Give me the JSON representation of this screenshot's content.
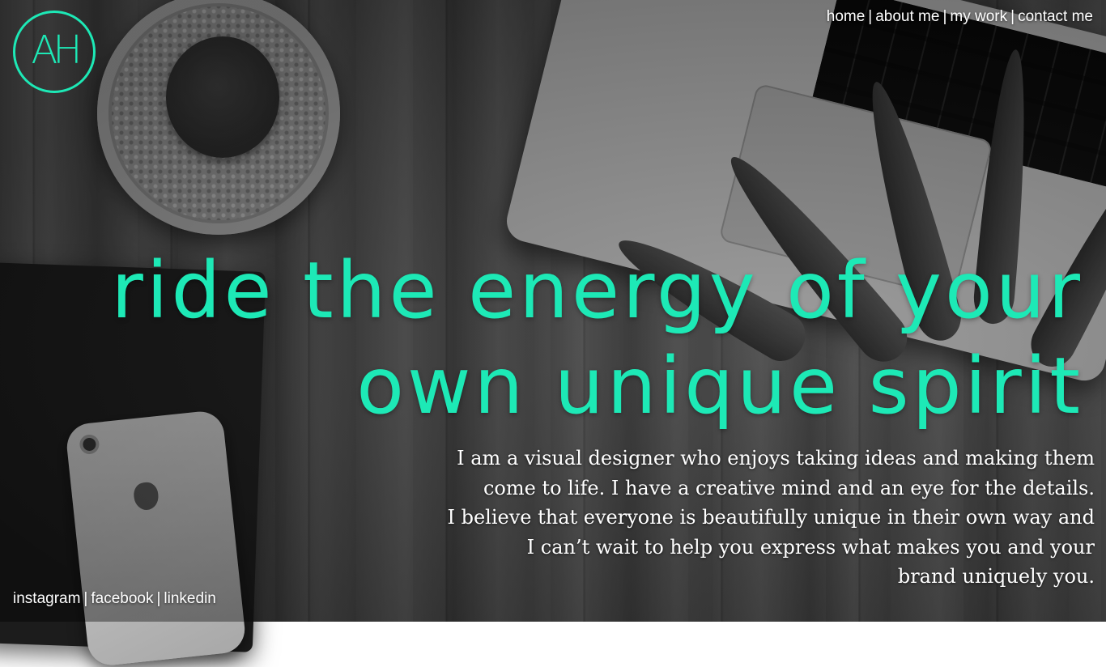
{
  "logo": {
    "text": "AH"
  },
  "nav": {
    "items": [
      "home",
      "about me",
      "my work",
      "contact me"
    ],
    "separator": "|"
  },
  "hero": {
    "headline_line1": "ride the energy of your",
    "headline_line2": "own unique spirit"
  },
  "bio": {
    "lines": [
      "I am a visual designer who enjoys taking ideas and making them",
      "come to life.  I have a creative mind and an eye for the details.",
      "I believe that everyone is beautifully unique in their own way and",
      "I can’t wait to help you express what makes you and your",
      "brand uniquely you."
    ]
  },
  "social": {
    "items": [
      "instagram",
      "facebook",
      "linkedin"
    ],
    "separator": "|"
  },
  "colors": {
    "accent": "#1de9b6",
    "text": "#ffffff",
    "background": "#4d4d4d"
  }
}
